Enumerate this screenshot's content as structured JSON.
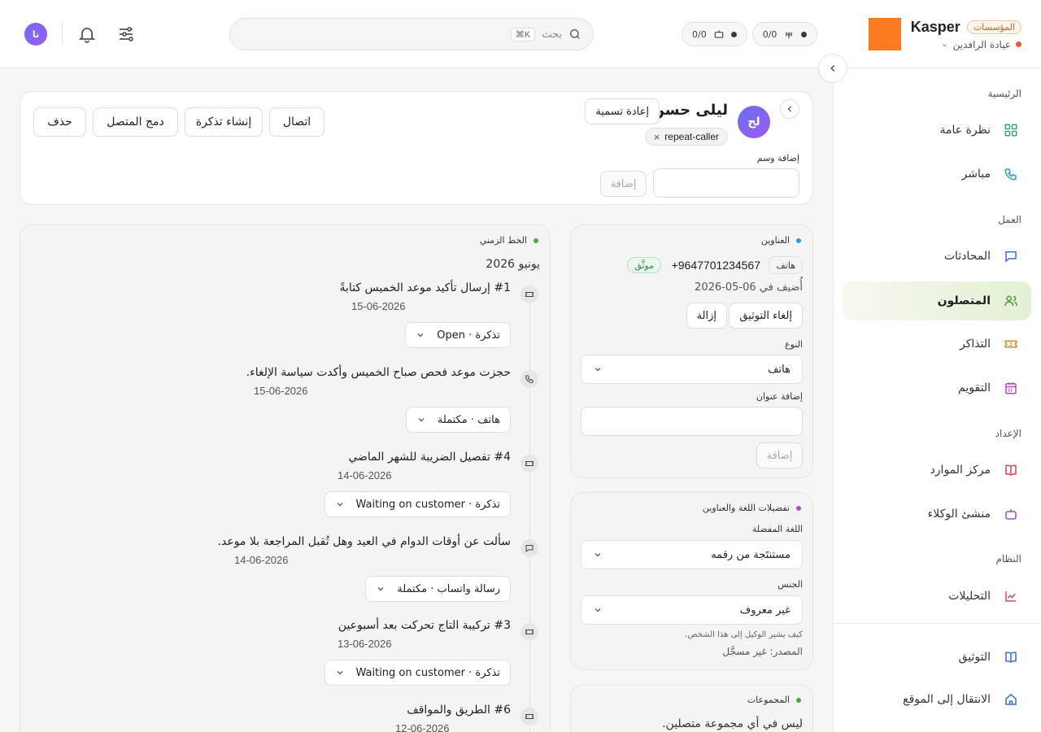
{
  "brand": {
    "name": "Kasper",
    "org_badge": "المؤسسات",
    "clinic": "عيادة الرافدين"
  },
  "topbar": {
    "counters": [
      {
        "value": "0/0",
        "icon": "antenna-icon"
      },
      {
        "value": "0/0",
        "icon": "robot-icon"
      }
    ],
    "search": {
      "placeholder": "بحث",
      "shortcut": "⌘K"
    },
    "user_initials": "نا"
  },
  "sidebar": {
    "sections": [
      {
        "label": "الرئيسية",
        "items": [
          {
            "label": "نظرة عامة",
            "icon": "grid-icon",
            "color": "#3aa57a"
          },
          {
            "label": "مباشر",
            "icon": "phone-icon",
            "color": "#2e9bb5"
          }
        ]
      },
      {
        "label": "العمل",
        "items": [
          {
            "label": "المحادثات",
            "icon": "chat-icon",
            "color": "#3b6fd1"
          },
          {
            "label": "المتصلون",
            "icon": "users-icon",
            "color": "#4a9a3c",
            "active": true
          },
          {
            "label": "التذاكر",
            "icon": "ticket-icon",
            "color": "#d88a1c"
          },
          {
            "label": "التقويم",
            "icon": "calendar-icon",
            "color": "#b04bb8"
          }
        ]
      },
      {
        "label": "الإعداد",
        "items": [
          {
            "label": "مركز الموارد",
            "icon": "book-icon",
            "color": "#d6455a"
          },
          {
            "label": "منشئ الوكلاء",
            "icon": "robot-icon",
            "color": "#8a52cf"
          }
        ]
      },
      {
        "label": "النظام",
        "items": [
          {
            "label": "التحليلات",
            "icon": "chart-icon",
            "color": "#d4458c"
          }
        ]
      }
    ],
    "footer": [
      {
        "label": "التوثيق",
        "icon": "docs-icon",
        "color": "#3b6fd1"
      },
      {
        "label": "الانتقال إلى الموقع",
        "icon": "home-icon",
        "color": "#3b6fd1"
      }
    ]
  },
  "contact": {
    "initials": "لح",
    "name": "ليلى حسن",
    "rename_label": "إعادة تسمية",
    "tag": "repeat-caller",
    "add_tag_label": "إضافة وسم",
    "add_button": "إضافة",
    "actions": {
      "call": "اتصال",
      "create_ticket": "إنشاء تذكرة",
      "merge": "دمج المتصل",
      "delete": "حذف"
    }
  },
  "addresses": {
    "title": "العناوين",
    "dot_color": "#2a9fd6",
    "type_tag": "هاتف",
    "phone": "+9647701234567",
    "verified": "موثَّق",
    "added": "أُضيف في 06-05-2026",
    "unverify": "إلغاء التوثيق",
    "remove": "إزالة",
    "type_label": "النوع",
    "type_value": "هاتف",
    "add_address_label": "إضافة عنوان",
    "add_button": "إضافة"
  },
  "prefs": {
    "title": "تفضيلات اللغة والعناوين",
    "dot_color": "#a84fd8",
    "lang_label": "اللغة المفضلة",
    "lang_value": "مستنتَجة من رقمه",
    "gender_label": "الجنس",
    "gender_value": "غير معروف",
    "hint": "كيف يشير الوكيل إلى هذا الشخص.",
    "source": "المصدر: غير مسجَّل"
  },
  "groups": {
    "title": "المجموعات",
    "dot_color": "#4aa83a",
    "empty": "ليس في أي مجموعة متصلين."
  },
  "timeline": {
    "title": "الخط الزمني",
    "dot_color": "#4aa83a",
    "month": "يونيو 2026",
    "items": [
      {
        "icon": "ticket-icon",
        "title": "#1 إرسال تأكيد موعد الخميس كتابةً",
        "date": "15-06-2026",
        "status": "تذكرة · Open"
      },
      {
        "icon": "phone-icon",
        "title": "حجزت موعد فحص صباح الخميس وأكدت سياسة الإلغاء.",
        "date": "15-06-2026",
        "status": "هاتف · مكتملة"
      },
      {
        "icon": "ticket-icon",
        "title": "#4 تفصيل الضريبة للشهر الماضي",
        "date": "14-06-2026",
        "status": "تذكرة · Waiting on customer"
      },
      {
        "icon": "chat-icon",
        "title": "سألت عن أوقات الدوام في العيد وهل تُقبل المراجعة بلا موعد.",
        "date": "14-06-2026",
        "status": "رسالة واتساب · مكتملة"
      },
      {
        "icon": "ticket-icon",
        "title": "#3 تركيبة التاج تحركت بعد أسبوعين",
        "date": "13-06-2026",
        "status": "تذكرة · Waiting on customer"
      },
      {
        "icon": "ticket-icon",
        "title": "#6 الطريق والمواقف",
        "date": "12-06-2026",
        "status": ""
      }
    ]
  }
}
